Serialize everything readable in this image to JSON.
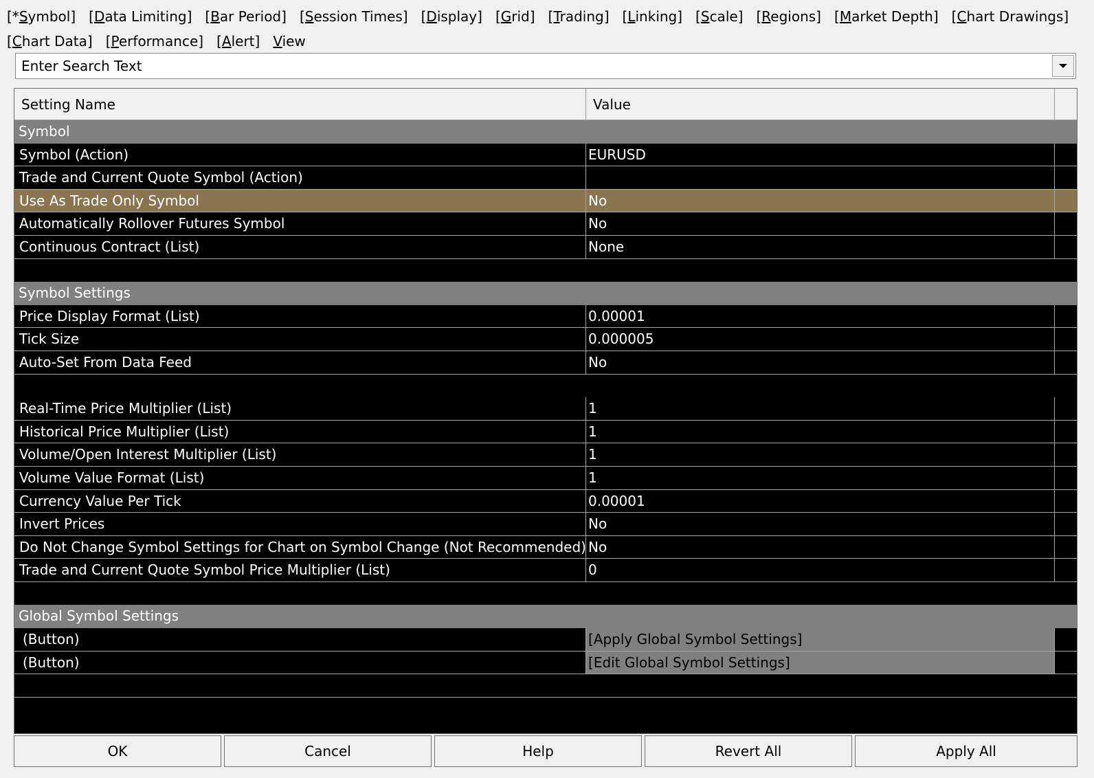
{
  "tabs": [
    {
      "pre": "[*",
      "key": "S",
      "post": "ymbol]"
    },
    {
      "pre": "[",
      "key": "D",
      "post": "ata Limiting]"
    },
    {
      "pre": "[",
      "key": "B",
      "post": "ar Period]"
    },
    {
      "pre": "[",
      "key": "S",
      "post": "ession Times]"
    },
    {
      "pre": "[",
      "key": "D",
      "post": "isplay]"
    },
    {
      "pre": "[",
      "key": "G",
      "post": "rid]"
    },
    {
      "pre": "[",
      "key": "T",
      "post": "rading]"
    },
    {
      "pre": "[",
      "key": "L",
      "post": "inking]"
    },
    {
      "pre": "[",
      "key": "S",
      "post": "cale]"
    },
    {
      "pre": "[",
      "key": "R",
      "post": "egions]"
    },
    {
      "pre": "[",
      "key": "M",
      "post": "arket Depth]"
    },
    {
      "pre": "[",
      "key": "C",
      "post": "hart Drawings]"
    },
    {
      "pre": "[",
      "key": "C",
      "post": "hart Data]"
    },
    {
      "pre": "[",
      "key": "P",
      "post": "erformance]"
    },
    {
      "pre": "[",
      "key": "A",
      "post": "lert]"
    },
    {
      "pre": "",
      "key": "V",
      "post": "iew"
    }
  ],
  "search": {
    "placeholder": "Enter Search Text"
  },
  "columns": {
    "name": "Setting Name",
    "value": "Value"
  },
  "rows": [
    {
      "kind": "group",
      "name": "Symbol"
    },
    {
      "kind": "setting",
      "name": "Symbol (Action)",
      "value": "EURUSD"
    },
    {
      "kind": "setting",
      "name": "Trade and Current Quote Symbol (Action)",
      "value": ""
    },
    {
      "kind": "setting",
      "name": "Use As Trade Only Symbol",
      "value": "No",
      "selected": true
    },
    {
      "kind": "setting",
      "name": "Automatically Rollover Futures Symbol",
      "value": "No"
    },
    {
      "kind": "setting",
      "name": "Continuous Contract (List)",
      "value": "None"
    },
    {
      "kind": "blank"
    },
    {
      "kind": "group",
      "name": "Symbol Settings"
    },
    {
      "kind": "setting",
      "name": "Price Display Format (List)",
      "value": "0.00001"
    },
    {
      "kind": "setting",
      "name": "Tick Size",
      "value": "0.000005"
    },
    {
      "kind": "setting",
      "name": "Auto-Set From Data Feed",
      "value": "No"
    },
    {
      "kind": "blank"
    },
    {
      "kind": "setting",
      "name": "Real-Time Price Multiplier (List)",
      "value": "1"
    },
    {
      "kind": "setting",
      "name": "Historical Price Multiplier (List)",
      "value": "1"
    },
    {
      "kind": "setting",
      "name": "Volume/Open Interest Multiplier (List)",
      "value": "1"
    },
    {
      "kind": "setting",
      "name": "Volume Value Format (List)",
      "value": "1"
    },
    {
      "kind": "setting",
      "name": "Currency Value Per Tick",
      "value": "0.00001"
    },
    {
      "kind": "setting",
      "name": "Invert Prices",
      "value": "No"
    },
    {
      "kind": "setting",
      "name": "Do Not Change Symbol Settings for Chart on Symbol Change (Not Recommended)",
      "value": "No"
    },
    {
      "kind": "setting",
      "name": "Trade and Current Quote Symbol Price Multiplier (List)",
      "value": "0"
    },
    {
      "kind": "blank"
    },
    {
      "kind": "group",
      "name": "Global Symbol Settings"
    },
    {
      "kind": "button",
      "name": "(Button)",
      "value": "[Apply Global Symbol Settings]"
    },
    {
      "kind": "button",
      "name": "(Button)",
      "value": "[Edit Global Symbol Settings]"
    },
    {
      "kind": "blank",
      "line": true
    },
    {
      "kind": "blank"
    }
  ],
  "buttons": {
    "ok": "OK",
    "cancel": "Cancel",
    "help": "Help",
    "revert": "Revert All",
    "apply": "Apply All"
  },
  "colors": {
    "group_bg": "#808080",
    "selected_bg": "#8b7551",
    "grid_bg": "#000000"
  }
}
